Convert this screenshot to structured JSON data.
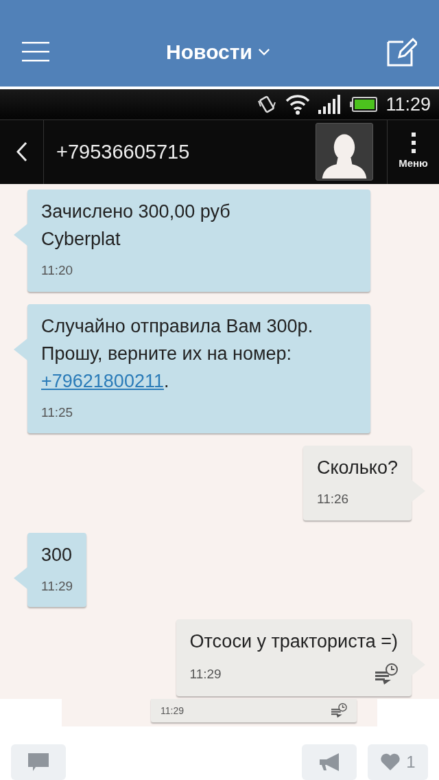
{
  "top_bar": {
    "title": "Новости"
  },
  "phone": {
    "status_time": "11:29",
    "contact": "+79536605715",
    "menu_label": "Меню",
    "messages": [
      {
        "kind": "incoming",
        "text": "Зачислено 300,00 руб Cyberplat",
        "time": "11:20",
        "pending": false
      },
      {
        "kind": "incoming",
        "text": "Случайно отправила Вам 300р. Прошу, верните их на номер: ",
        "link": "+79621800211",
        "text_after": ".",
        "time": "11:25",
        "pending": false
      },
      {
        "kind": "outgoing",
        "text": "Сколько?",
        "time": "11:26",
        "pending": false
      },
      {
        "kind": "incoming",
        "text": "300",
        "time": "11:29",
        "pending": false
      },
      {
        "kind": "outgoing",
        "text": "Отсоси у тракториста =)",
        "time": "11:29",
        "pending": true
      }
    ],
    "fragment": {
      "time": "11:29",
      "pending": true
    }
  },
  "actions": {
    "likes": "1"
  }
}
